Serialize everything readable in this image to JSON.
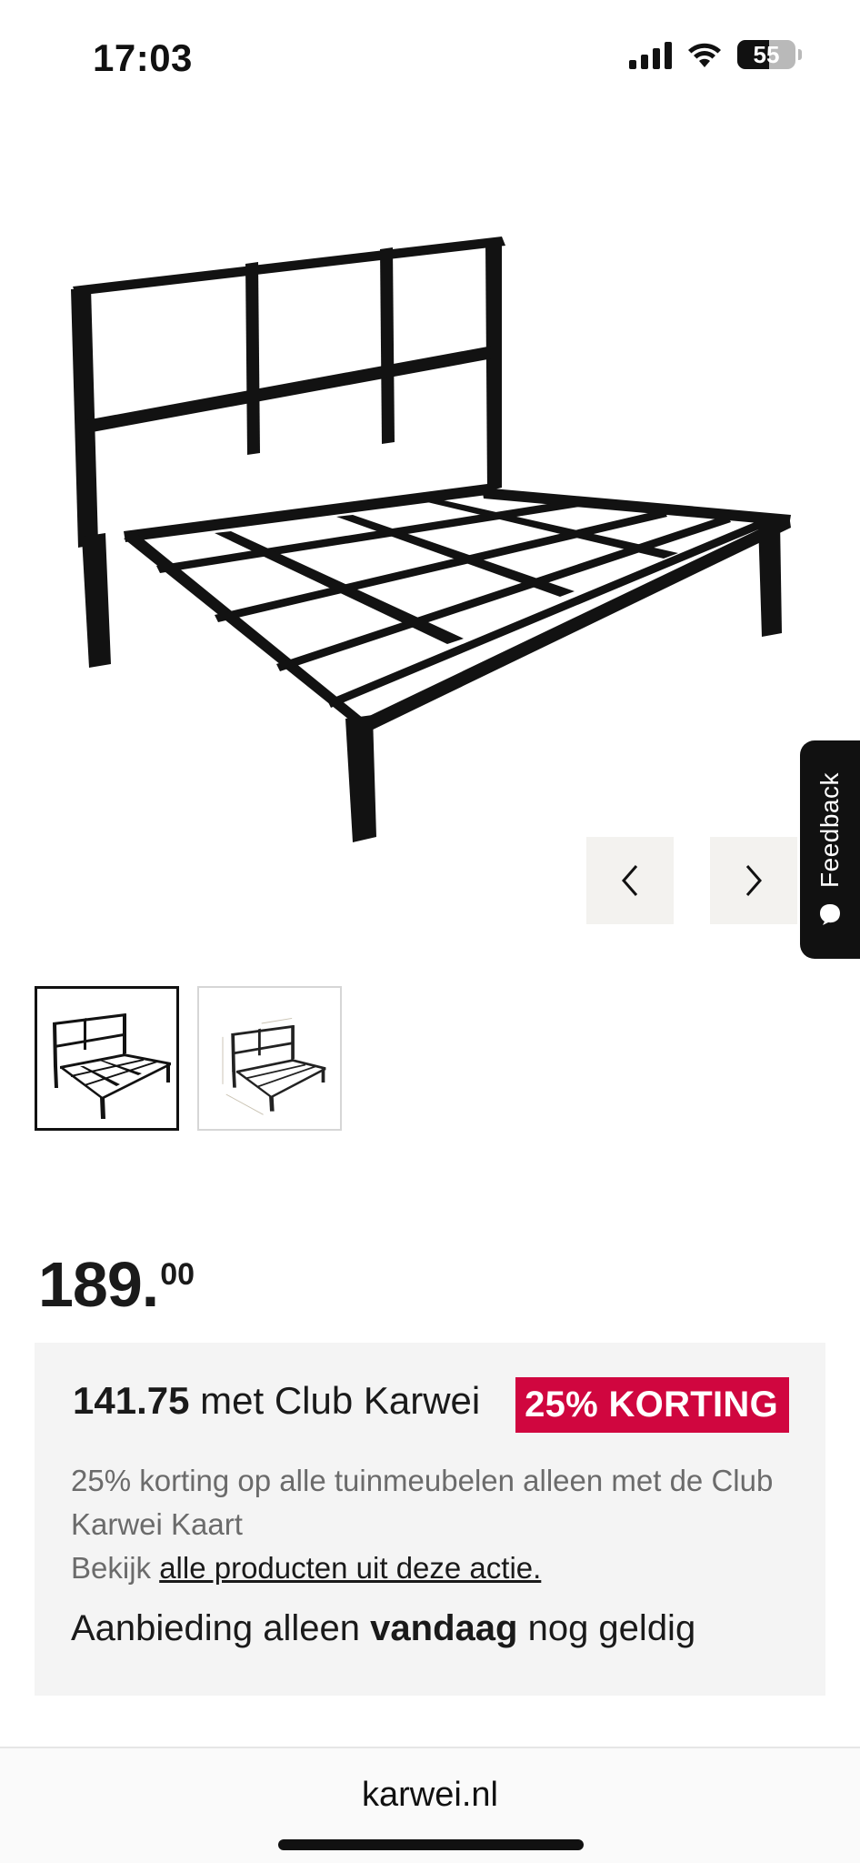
{
  "status_bar": {
    "time": "17:03",
    "battery": "55"
  },
  "product": {
    "image": "black-metal-garden-sofa-frame",
    "thumbnails": [
      "thumbnail-1",
      "thumbnail-2"
    ],
    "price_main": "189.",
    "price_cents": "00"
  },
  "carousel": {
    "prev_icon": "chevron-left-icon",
    "next_icon": "chevron-right-icon"
  },
  "feedback": {
    "label": "Feedback"
  },
  "offer": {
    "club_price": "141.75",
    "club_text": " met Club Karwei",
    "badge": "25% KORTING",
    "description": "25% korting op alle tuinmeubelen alleen met de Club Karwei Kaart",
    "link_prefix": "Bekijk ",
    "link_text": "alle producten uit deze actie.",
    "valid_prefix": "Aanbieding alleen ",
    "valid_bold": "vandaag",
    "valid_suffix": " nog geldig"
  },
  "browser": {
    "url": "karwei.nl"
  },
  "colors": {
    "badge": "#d0063f",
    "offer_bg": "#f4f4f4",
    "nav_button_bg": "#f3f2ef"
  }
}
